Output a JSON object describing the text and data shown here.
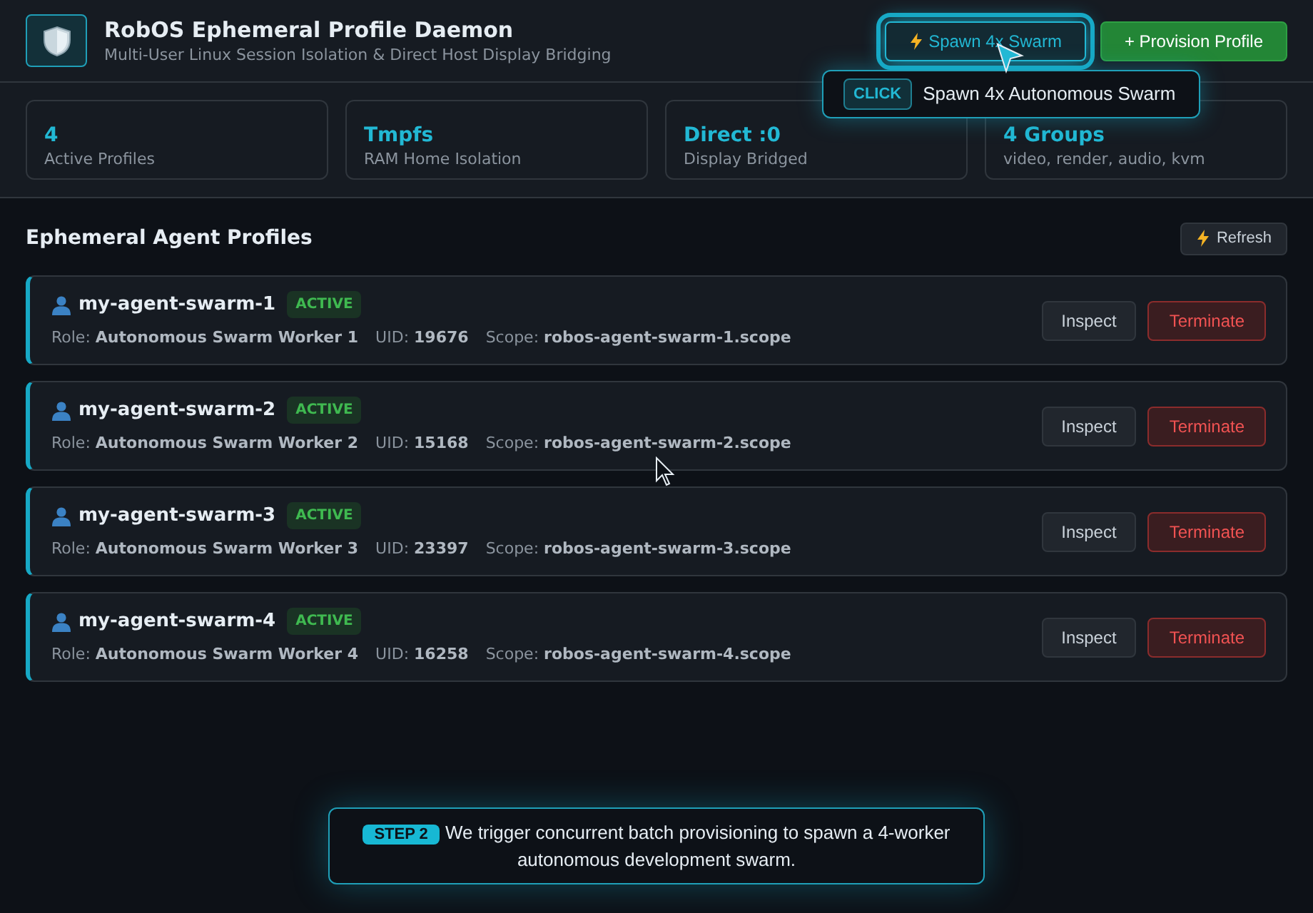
{
  "header": {
    "title": "RobOS Ephemeral Profile Daemon",
    "subtitle": "Multi-User Linux Session Isolation & Direct Host Display Bridging",
    "buttons": [
      {
        "label": "Spawn 4x Swarm",
        "kind": "spawn",
        "highlighted": true
      },
      {
        "label": "+ Provision Profile",
        "kind": "primary",
        "highlighted": false
      }
    ]
  },
  "tooltip": {
    "badge": "CLICK",
    "text": "Spawn 4x Autonomous Swarm"
  },
  "stats": [
    {
      "value": "4",
      "label": "Active Profiles"
    },
    {
      "value": "Tmpfs",
      "label": "RAM Home Isolation"
    },
    {
      "value": "Direct :0",
      "label": "Display Bridged"
    },
    {
      "value": "4 Groups",
      "label": "video, render, audio, kvm"
    }
  ],
  "section": {
    "title": "Ephemeral Agent Profiles",
    "refresh": "Refresh"
  },
  "profiles": [
    {
      "name": "my-agent-swarm-1",
      "status": "ACTIVE",
      "role_label": "Role:",
      "role": "Autonomous Swarm Worker 1",
      "uid_label": "UID:",
      "uid": "19676",
      "scope_label": "Scope:",
      "scope": "robos-agent-swarm-1.scope",
      "actions": [
        "Inspect",
        "Terminate"
      ]
    },
    {
      "name": "my-agent-swarm-2",
      "status": "ACTIVE",
      "role_label": "Role:",
      "role": "Autonomous Swarm Worker 2",
      "uid_label": "UID:",
      "uid": "15168",
      "scope_label": "Scope:",
      "scope": "robos-agent-swarm-2.scope",
      "actions": [
        "Inspect",
        "Terminate"
      ]
    },
    {
      "name": "my-agent-swarm-3",
      "status": "ACTIVE",
      "role_label": "Role:",
      "role": "Autonomous Swarm Worker 3",
      "uid_label": "UID:",
      "uid": "23397",
      "scope_label": "Scope:",
      "scope": "robos-agent-swarm-3.scope",
      "actions": [
        "Inspect",
        "Terminate"
      ]
    },
    {
      "name": "my-agent-swarm-4",
      "status": "ACTIVE",
      "role_label": "Role:",
      "role": "Autonomous Swarm Worker 4",
      "uid_label": "UID:",
      "uid": "16258",
      "scope_label": "Scope:",
      "scope": "robos-agent-swarm-4.scope",
      "actions": [
        "Inspect",
        "Terminate"
      ]
    }
  ],
  "caption": {
    "badge": "STEP 2",
    "text": "We trigger concurrent batch provisioning to spawn a 4-worker autonomous development swarm."
  }
}
